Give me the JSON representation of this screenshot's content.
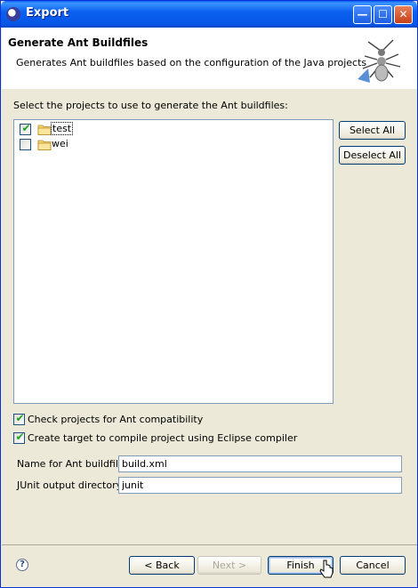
{
  "window": {
    "title": "Export"
  },
  "banner": {
    "title": "Generate Ant Buildfiles",
    "description": "Generates Ant buildfiles based on the configuration of the Java projects"
  },
  "projects": {
    "instruction": "Select the projects to use to generate the Ant buildfiles:",
    "items": [
      {
        "label": "test",
        "checked": true
      },
      {
        "label": "wei",
        "checked": false
      }
    ],
    "select_all_label": "Select All",
    "deselect_all_label": "Deselect All"
  },
  "options": {
    "check_compat_label": "Check projects for Ant compatibility",
    "check_compat_checked": true,
    "create_target_label": "Create target to compile project using Eclipse compiler",
    "create_target_checked": true
  },
  "fields": {
    "buildfile_label": "Name for Ant buildfile:",
    "buildfile_value": "build.xml",
    "junit_label": "JUnit output directory:",
    "junit_value": "junit"
  },
  "footer": {
    "help_glyph": "?",
    "back_label": "< Back",
    "next_label": "Next >",
    "finish_label": "Finish",
    "cancel_label": "Cancel"
  },
  "titlebar_buttons": {
    "minimize": "—",
    "maximize": "☐",
    "close": "✕"
  },
  "icons": [
    "eclipse-icon",
    "ant-icon",
    "folder-icon",
    "help-icon",
    "mouse-cursor"
  ]
}
